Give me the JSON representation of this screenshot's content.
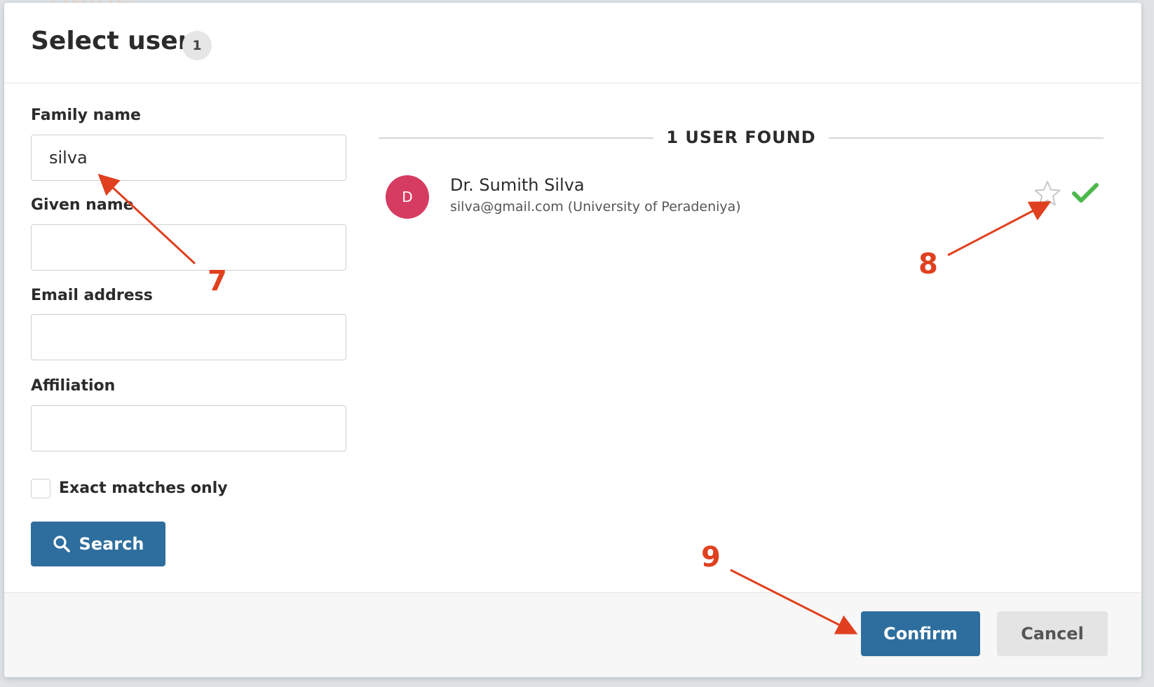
{
  "background": {
    "title_fragment": "Home"
  },
  "modal": {
    "title": "Select users",
    "count_badge": "1"
  },
  "form": {
    "family_name": {
      "label": "Family name",
      "value": "silva",
      "placeholder": ""
    },
    "given_name": {
      "label": "Given name",
      "value": "",
      "placeholder": ""
    },
    "email_address": {
      "label": "Email address",
      "value": "",
      "placeholder": ""
    },
    "affiliation": {
      "label": "Affiliation",
      "value": "",
      "placeholder": ""
    },
    "exact_matches": {
      "label": "Exact matches only",
      "checked": false
    },
    "search_button": {
      "label": "Search"
    }
  },
  "results": {
    "header": "1 USER FOUND",
    "users": [
      {
        "avatar_initial": "D",
        "avatar_color": "#d63b61",
        "name": "Dr. Sumith Silva",
        "detail": "silva@gmail.com (University of Peradeniya)",
        "favorite": false,
        "selected": true
      }
    ]
  },
  "footer": {
    "confirm_label": "Confirm",
    "cancel_label": "Cancel"
  },
  "annotations": {
    "step_7": "7",
    "step_8": "8",
    "step_9": "9",
    "color": "#e0401f"
  },
  "colors": {
    "primary": "#2e6e9e",
    "success_check": "#4cb84c",
    "star_outline": "#c8c8c8"
  }
}
